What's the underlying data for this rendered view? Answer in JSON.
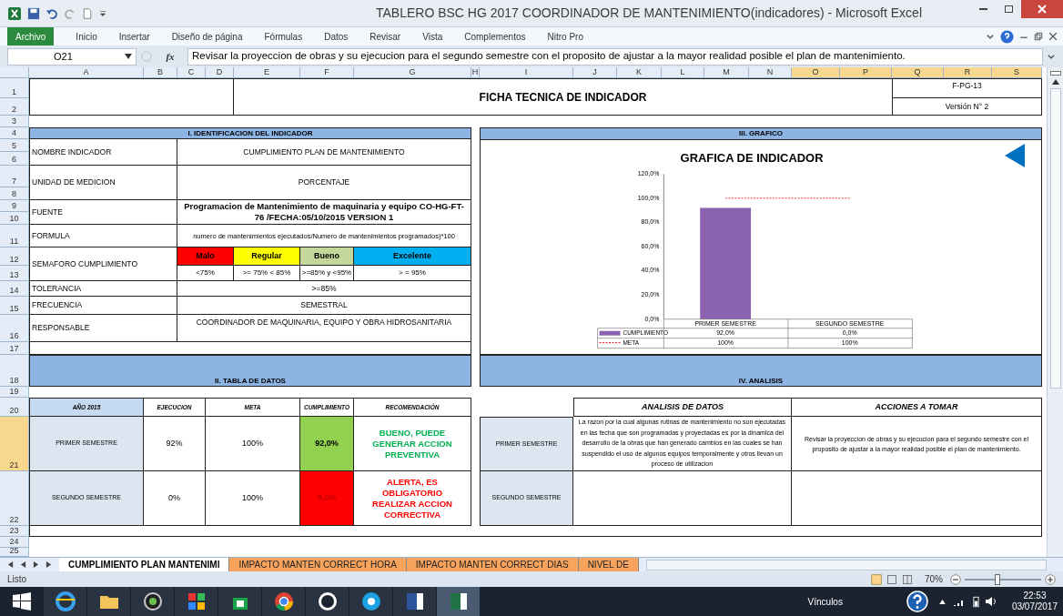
{
  "window": {
    "title": "TABLERO BSC HG 2017 COORDINADOR DE MANTENIMIENTO(indicadores)  -  Microsoft Excel"
  },
  "ribbon_tabs": [
    {
      "label": "Archivo",
      "selected": true
    },
    {
      "label": "Inicio",
      "selected": false
    },
    {
      "label": "Insertar",
      "selected": false
    },
    {
      "label": "Diseño de página",
      "selected": false
    },
    {
      "label": "Fórmulas",
      "selected": false
    },
    {
      "label": "Datos",
      "selected": false
    },
    {
      "label": "Revisar",
      "selected": false
    },
    {
      "label": "Vista",
      "selected": false
    },
    {
      "label": "Complementos",
      "selected": false
    },
    {
      "label": "Nitro Pro",
      "selected": false
    }
  ],
  "formula_bar": {
    "name_box": "O21",
    "fx": "fx",
    "formula": "Revisar la proyeccion de obras y su ejecucion para el segundo semestre con el proposito de ajustar a la mayor realidad posible el  plan de mantenimiento."
  },
  "columns": [
    {
      "label": "A",
      "selected": false
    },
    {
      "label": "B",
      "selected": false
    },
    {
      "label": "C",
      "selected": false
    },
    {
      "label": "D",
      "selected": false
    },
    {
      "label": "E",
      "selected": false
    },
    {
      "label": "F",
      "selected": false
    },
    {
      "label": "G",
      "selected": false
    },
    {
      "label": "H",
      "selected": false
    },
    {
      "label": "I",
      "selected": false
    },
    {
      "label": "J",
      "selected": false
    },
    {
      "label": "K",
      "selected": false
    },
    {
      "label": "L",
      "selected": false
    },
    {
      "label": "M",
      "selected": false
    },
    {
      "label": "N",
      "selected": false
    },
    {
      "label": "O",
      "selected": true
    },
    {
      "label": "P",
      "selected": true
    },
    {
      "label": "Q",
      "selected": true
    },
    {
      "label": "R",
      "selected": true
    },
    {
      "label": "S",
      "selected": true
    }
  ],
  "rows": [
    {
      "label": "1",
      "selected": false
    },
    {
      "label": "2",
      "selected": false
    },
    {
      "label": "3",
      "selected": false
    },
    {
      "label": "4",
      "selected": false
    },
    {
      "label": "5",
      "selected": false
    },
    {
      "label": "6",
      "selected": false
    },
    {
      "label": "7",
      "selected": false
    },
    {
      "label": "8",
      "selected": false
    },
    {
      "label": "9",
      "selected": false
    },
    {
      "label": "10",
      "selected": false
    },
    {
      "label": "11",
      "selected": false
    },
    {
      "label": "12",
      "selected": false
    },
    {
      "label": "13",
      "selected": false
    },
    {
      "label": "14",
      "selected": false
    },
    {
      "label": "15",
      "selected": false
    },
    {
      "label": "16",
      "selected": false
    },
    {
      "label": "17",
      "selected": false
    },
    {
      "label": "18",
      "selected": false
    },
    {
      "label": "19",
      "selected": false
    },
    {
      "label": "20",
      "selected": false
    },
    {
      "label": "21",
      "selected": true
    },
    {
      "label": "22",
      "selected": false
    },
    {
      "label": "23",
      "selected": false
    },
    {
      "label": "24",
      "selected": false
    },
    {
      "label": "25",
      "selected": false
    }
  ],
  "header": {
    "title": "FICHA TECNICA DE INDICADOR",
    "code": "F-PG-13",
    "version": "Versión N° 2"
  },
  "identification": {
    "title": "I.  IDENTIFICACION DEL INDICADOR",
    "fields": [
      {
        "kind": "plain",
        "label": "NOMBRE INDICADOR",
        "value": "CUMPLIMIENTO PLAN DE MANTENIMIENTO"
      },
      {
        "kind": "plain",
        "label": "UNIDAD DE MEDICION",
        "value": "PORCENTAJE"
      },
      {
        "kind": "bold",
        "label": "FUENTE",
        "value": "Programacion  de Mantenimiento de maquinaria y equipo CO-HG-FT-76 /FECHA:05/10/2015 VERSION 1"
      },
      {
        "kind": "small",
        "label": "FORMULA",
        "value": "numero de mantenimientos ejecutados/Numero de mantenimientos programados)*100"
      },
      {
        "kind": "semaforo",
        "label": "SEMAFORO CUMPLIMIENTO",
        "levels": [
          {
            "name": "Malo",
            "threshold": "<75%",
            "color": "#ff0000"
          },
          {
            "name": "Regular",
            "threshold": ">=  75% < 85%",
            "color": "#ffff00"
          },
          {
            "name": "Bueno",
            "threshold": ">=85% y <95%",
            "color": "#c4d79b"
          },
          {
            "name": "Excelente",
            "threshold": "> = 95%",
            "color": "#00b0f0"
          }
        ]
      },
      {
        "kind": "plain",
        "label": "TOLERANCIA",
        "value": ">=85%"
      },
      {
        "kind": "plain",
        "label": "FRECUENCIA",
        "value": "SEMESTRAL"
      },
      {
        "kind": "top",
        "label": "RESPONSABLE",
        "value": "COORDINADOR DE MAQUINARIA, EQUIPO Y OBRA HIDROSANITARIA"
      }
    ]
  },
  "chart": {
    "title": "III.  GRAFICO",
    "chart_data": {
      "type": "bar",
      "title": "GRAFICA DE INDICADOR",
      "categories": [
        "PRIMER SEMESTRE",
        "SEGUNDO SEMESTRE"
      ],
      "series": [
        {
          "name": "CUMPLIMIENTO",
          "color": "#8a62b0",
          "values": [
            92,
            0
          ]
        },
        {
          "name": "META",
          "color": "#ff0000",
          "values": [
            100,
            100
          ],
          "type": "line",
          "line_style": "dashed"
        }
      ],
      "legend": "bottom",
      "ylim": [
        0,
        120
      ],
      "yticks": [
        {
          "value": 0,
          "label": "0,0%"
        },
        {
          "value": 20,
          "label": "20,0%"
        },
        {
          "value": 40,
          "label": "40,0%"
        },
        {
          "value": 60,
          "label": "60,0%"
        },
        {
          "value": 80,
          "label": "80,0%"
        },
        {
          "value": 100,
          "label": "100,0%"
        },
        {
          "value": 120,
          "label": "120,0%"
        }
      ]
    },
    "table_cells": [
      [
        "92,0%",
        "0,0%"
      ],
      [
        "100%",
        "100%"
      ]
    ]
  },
  "data_table": {
    "title": "II.  TABLA DE DATOS",
    "columns": [
      "AÑO 2015",
      "EJECUCION",
      "META",
      "CUMPLIMIENTO",
      "RECOMENDACIÓN"
    ],
    "rows": [
      {
        "period": "PRIMER SEMESTRE",
        "ejecucion": "92%",
        "meta": "100%",
        "cumplimiento": "92,0%",
        "recomendacion": "BUENO, PUEDE GENERAR ACCION PREVENTIVA",
        "color": "#92d050",
        "kind": "good"
      },
      {
        "period": "SEGUNDO SEMESTRE",
        "ejecucion": "0%",
        "meta": "100%",
        "cumplimiento": "0,0%",
        "recomendacion": "ALERTA, ES OBLIGATORIO REALIZAR ACCION CORRECTIVA",
        "color": "#ff0000",
        "kind": "alert"
      }
    ]
  },
  "analysis": {
    "title": "IV.  ANALISIS",
    "columns": [
      "ANALISIS DE DATOS",
      "ACCIONES A TOMAR"
    ],
    "rows": [
      {
        "period": "PRIMER SEMESTRE",
        "analysis": "La razon por la cual algunas rutinas de mantenimiento no son ejecutadas en las fecha que son programadas y proyectadas es por la dinamica del desarrollo de la obras que han generado cambios en las cuales se han suspendido el uso de algunos equipos temporalmente y otros llevan un proceso de utilizacion",
        "actions": "Revisar la proyeccion de obras y su ejecucion para el segundo semestre con el proposito de ajustar a la mayor realidad posible el  plan de mantenimiento."
      },
      {
        "period": "SEGUNDO SEMESTRE"
      }
    ]
  },
  "sheet_tabs": [
    {
      "label": "CUMPLIMIENTO PLAN MANTENIMI",
      "selected": true
    },
    {
      "label": "IMPACTO MANTEN CORRECT HORA",
      "selected": false
    },
    {
      "label": "IMPACTO MANTEN CORRECT DIAS",
      "selected": false
    },
    {
      "label": "NIVEL DE",
      "selected": false
    }
  ],
  "status_bar": {
    "status": "Listo",
    "zoom": "70%",
    "level": 0.43
  },
  "taskbar": {
    "links": "Vínculos",
    "time": "22:53",
    "date": "03/07/2017"
  }
}
